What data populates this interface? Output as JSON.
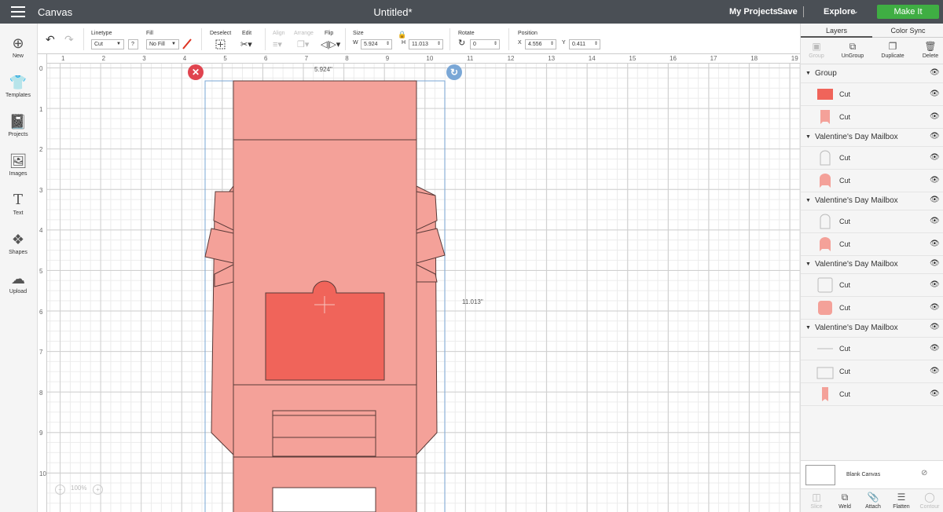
{
  "header": {
    "app_title": "Canvas",
    "doc_title": "Untitled*",
    "my_projects": "My Projects",
    "save": "Save",
    "explore": "Explore",
    "make_it": "Make It"
  },
  "toolbar": {
    "linetype_label": "Linetype",
    "linetype_value": "Cut",
    "help": "?",
    "fill_label": "Fill",
    "fill_value": "No Fill",
    "deselect_label": "Deselect",
    "edit_label": "Edit",
    "align_label": "Align",
    "arrange_label": "Arrange",
    "flip_label": "Flip",
    "size_label": "Size",
    "w_label": "W",
    "w_value": "5.924",
    "h_label": "H",
    "h_value": "11.013",
    "rotate_label": "Rotate",
    "rotate_value": "0",
    "position_label": "Position",
    "x_label": "X",
    "x_value": "4.556",
    "y_label": "Y",
    "y_value": "0.411"
  },
  "leftbar": {
    "items": [
      {
        "label": "New",
        "icon": "plus-circle-icon"
      },
      {
        "label": "Templates",
        "icon": "tshirt-icon"
      },
      {
        "label": "Projects",
        "icon": "notebook-icon"
      },
      {
        "label": "Images",
        "icon": "image-icon"
      },
      {
        "label": "Text",
        "icon": "text-icon"
      },
      {
        "label": "Shapes",
        "icon": "shapes-icon"
      },
      {
        "label": "Upload",
        "icon": "upload-cloud-icon"
      }
    ]
  },
  "canvas": {
    "ruler_top": [
      "1",
      "2",
      "3",
      "4",
      "5",
      "6",
      "7",
      "8",
      "9",
      "10",
      "11",
      "12",
      "13",
      "14",
      "15",
      "16",
      "17",
      "18",
      "19"
    ],
    "ruler_left": [
      "0",
      "1",
      "2",
      "3",
      "4",
      "5",
      "6",
      "7",
      "8",
      "9",
      "10"
    ],
    "width_dim": "5.924\"",
    "height_dim": "11.013\"",
    "zoom": "100%",
    "colors": {
      "fill_light": "#f4a199",
      "fill_dark": "#f0645a",
      "stroke": "#5a3a38",
      "selection": "#7aa7d6"
    }
  },
  "panel": {
    "tabs": [
      "Layers",
      "Color Sync"
    ],
    "actions": [
      {
        "label": "Group",
        "disabled": true
      },
      {
        "label": "UnGroup",
        "disabled": false
      },
      {
        "label": "Duplicate",
        "disabled": false
      },
      {
        "label": "Delete",
        "disabled": false
      }
    ],
    "groups": [
      {
        "name": "Group",
        "layers": [
          {
            "name": "Cut",
            "thumb": "dark-rect"
          },
          {
            "name": "Cut",
            "thumb": "light-tab"
          }
        ]
      },
      {
        "name": "Valentine's Day Mailbox",
        "layers": [
          {
            "name": "Cut",
            "thumb": "outline-arch"
          },
          {
            "name": "Cut",
            "thumb": "light-arch"
          }
        ]
      },
      {
        "name": "Valentine's Day Mailbox",
        "layers": [
          {
            "name": "Cut",
            "thumb": "outline-arch"
          },
          {
            "name": "Cut",
            "thumb": "light-arch"
          }
        ]
      },
      {
        "name": "Valentine's Day Mailbox",
        "layers": [
          {
            "name": "Cut",
            "thumb": "outline-square"
          },
          {
            "name": "Cut",
            "thumb": "light-square"
          }
        ]
      },
      {
        "name": "Valentine's Day Mailbox",
        "layers": [
          {
            "name": "Cut",
            "thumb": "outline-line"
          },
          {
            "name": "Cut",
            "thumb": "outline-rect"
          },
          {
            "name": "Cut",
            "thumb": "light-flag"
          }
        ]
      }
    ],
    "blank_canvas": "Blank Canvas",
    "bottom_actions": [
      {
        "label": "Slice",
        "disabled": true
      },
      {
        "label": "Weld",
        "disabled": false
      },
      {
        "label": "Attach",
        "disabled": false
      },
      {
        "label": "Flatten",
        "disabled": false
      },
      {
        "label": "Contour",
        "disabled": true
      }
    ]
  }
}
